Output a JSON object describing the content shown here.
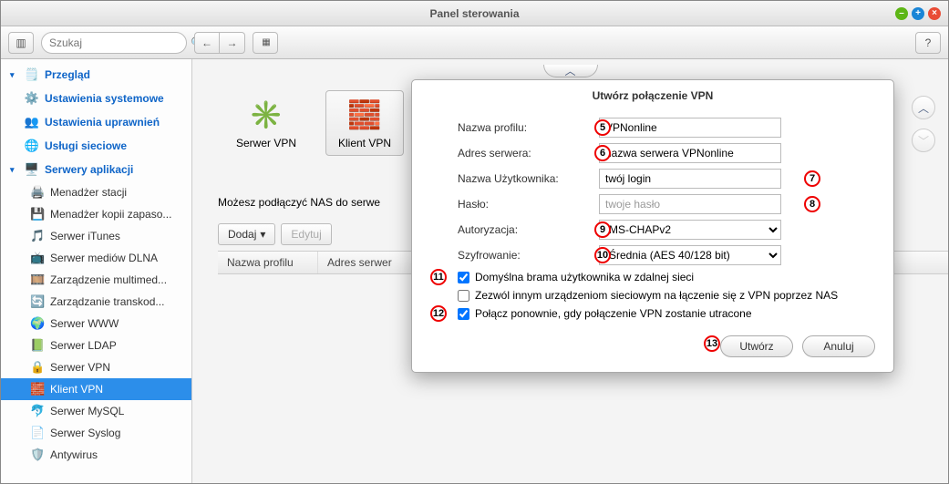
{
  "window": {
    "title": "Panel sterowania"
  },
  "toolbar": {
    "search_placeholder": "Szukaj"
  },
  "sidebar": {
    "overview": "Przegląd",
    "system_settings": "Ustawienia systemowe",
    "perm_settings": "Ustawienia uprawnień",
    "net_services": "Usługi sieciowe",
    "app_servers": "Serwery aplikacji",
    "items": [
      "Menadżer stacji",
      "Menadżer kopii zapaso...",
      "Serwer iTunes",
      "Serwer mediów DLNA",
      "Zarządzenie multimed...",
      "Zarządzanie transkod...",
      "Serwer WWW",
      "Serwer LDAP",
      "Serwer VPN",
      "Klient VPN",
      "Serwer MySQL",
      "Serwer Syslog",
      "Antywirus"
    ]
  },
  "content": {
    "tab_server": "Serwer VPN",
    "tab_client": "Klient VPN",
    "info_text": "Możesz podłączyć NAS do serwe",
    "btn_add": "Dodaj",
    "btn_edit": "Edytuj",
    "col_profile": "Nazwa profilu",
    "col_server": "Adres serwer"
  },
  "modal": {
    "title": "Utwórz połączenie VPN",
    "lbl_profile": "Nazwa profilu:",
    "lbl_server": "Adres serwera:",
    "lbl_user": "Nazwa Użytkownika:",
    "lbl_pass": "Hasło:",
    "lbl_auth": "Autoryzacja:",
    "lbl_enc": "Szyfrowanie:",
    "val_profile": "VPNonline",
    "val_server": "nazwa serwera VPNonline",
    "val_user": "twój login",
    "val_pass": "twoje hasło",
    "val_auth": "MS-CHAPv2",
    "val_enc": "Średnia (AES 40/128 bit)",
    "chk1": "Domyślna brama użytkownika w zdalnej sieci",
    "chk2": "Zezwól innym urządzeniom sieciowym na łączenie się z VPN poprzez NAS",
    "chk3": "Połącz ponownie, gdy połączenie VPN zostanie utracone",
    "btn_create": "Utwórz",
    "btn_cancel": "Anuluj"
  },
  "badges": {
    "b5": "5",
    "b6": "6",
    "b7": "7",
    "b8": "8",
    "b9": "9",
    "b10": "10",
    "b11": "11",
    "b12": "12",
    "b13": "13"
  }
}
